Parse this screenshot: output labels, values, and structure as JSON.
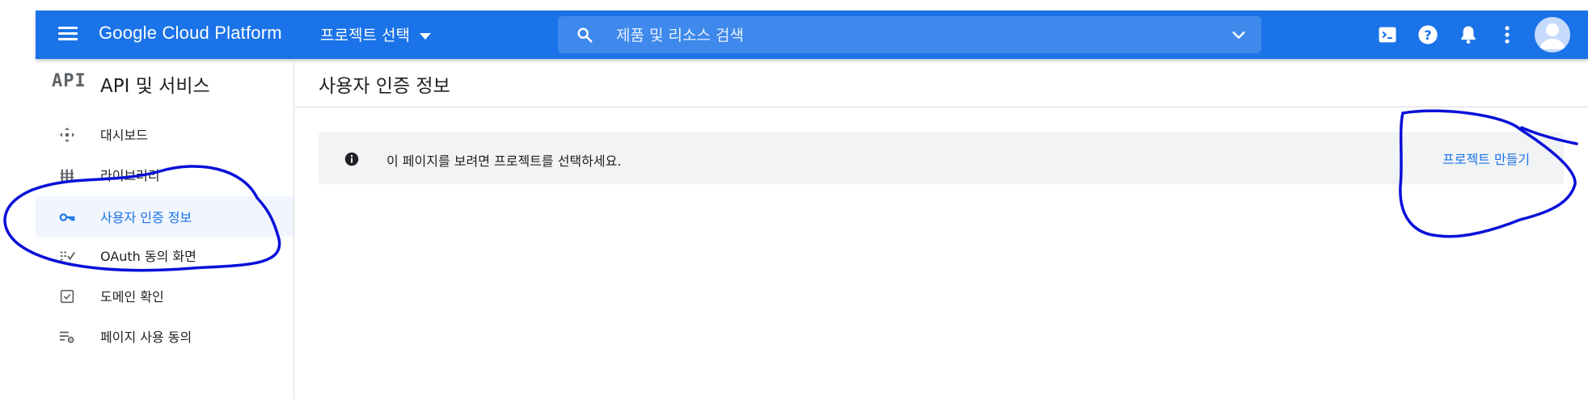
{
  "header": {
    "logo": "Google Cloud Platform",
    "project_selector": "프로젝트 선택",
    "search_placeholder": "제품 및 리소스 검색",
    "icons": [
      "menu-icon",
      "search-icon",
      "chevron-down-icon",
      "cloud-shell-icon",
      "help-icon",
      "notifications-icon",
      "more-vert-icon",
      "account-icon"
    ]
  },
  "sidebar": {
    "api_mark": "API",
    "title": "API 및 서비스",
    "items": [
      {
        "label": "대시보드",
        "icon": "dashboard-icon",
        "active": false
      },
      {
        "label": "라이브러리",
        "icon": "library-icon",
        "active": false
      },
      {
        "label": "사용자 인증 정보",
        "icon": "key-icon",
        "active": true
      },
      {
        "label": "OAuth 동의 화면",
        "icon": "consent-icon",
        "active": false
      },
      {
        "label": "도메인 확인",
        "icon": "checkbox-icon",
        "active": false
      },
      {
        "label": "페이지 사용 동의",
        "icon": "settings-list-icon",
        "active": false
      }
    ]
  },
  "main": {
    "title": "사용자 인증 정보",
    "banner_message": "이 페이지를 보려면 프로젝트를 선택하세요.",
    "create_project_label": "프로젝트 만들기"
  },
  "colors": {
    "header_blue": "#1a73e8",
    "annotation_ink": "#0a10d8"
  }
}
